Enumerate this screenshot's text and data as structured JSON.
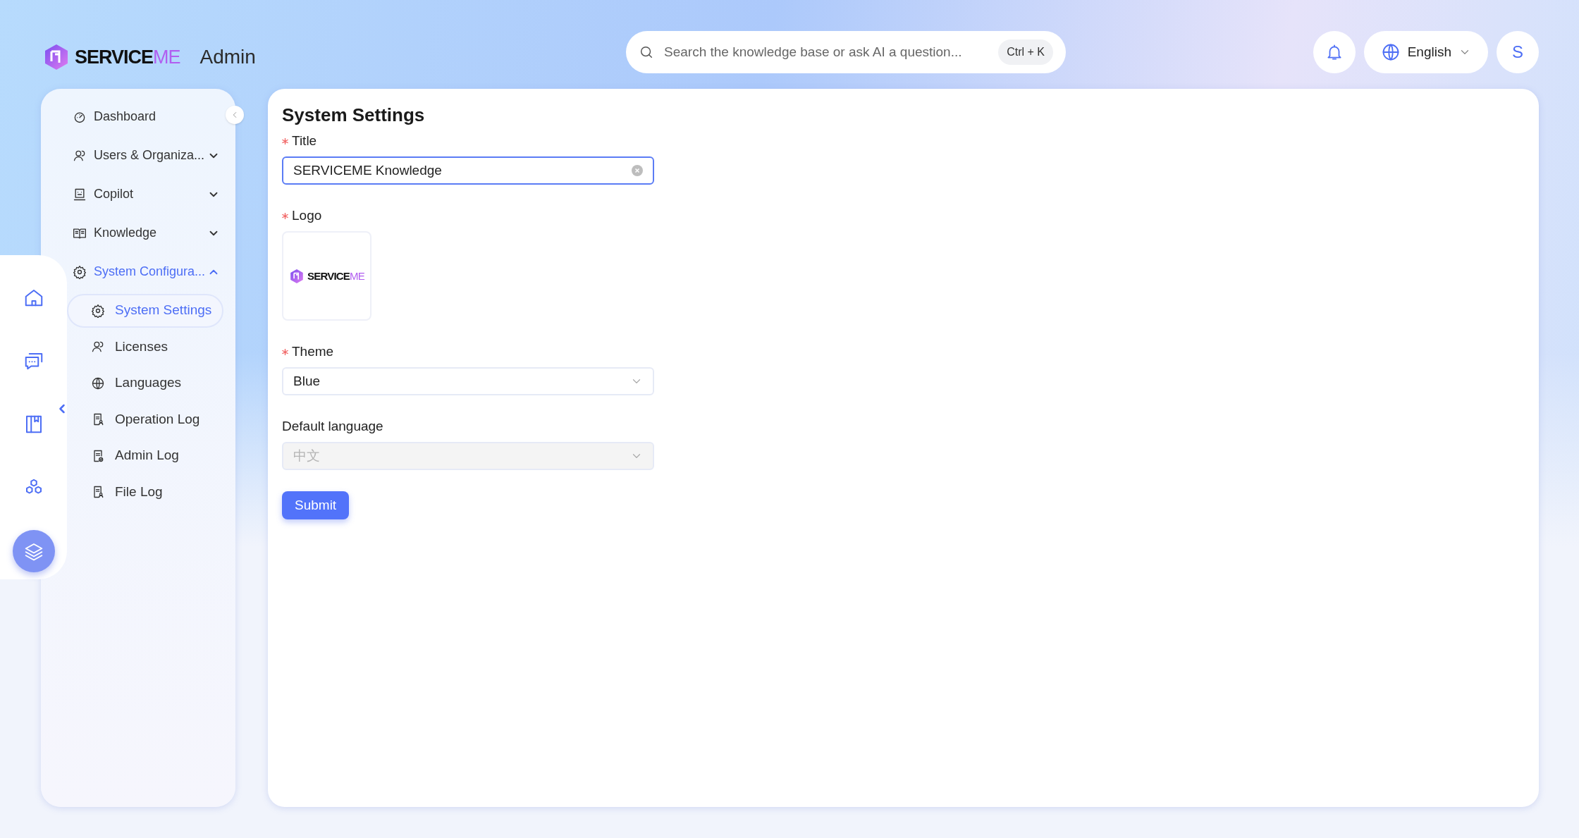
{
  "header": {
    "brand": {
      "main": "SERVICE",
      "accent": "ME"
    },
    "app_label": "Admin",
    "search": {
      "placeholder": "Search the knowledge base or ask AI a question...",
      "shortcut": "Ctrl + K"
    },
    "language": "English",
    "avatar": "S"
  },
  "rail": [
    {
      "selected": false
    },
    {
      "selected": false
    },
    {
      "selected": false
    },
    {
      "selected": false
    },
    {
      "selected": true
    }
  ],
  "sidebar": {
    "items": [
      {
        "label": "Dashboard",
        "selected": false
      },
      {
        "label": "Users & Organiza...",
        "expanded": false,
        "selected": false
      },
      {
        "label": "Copilot",
        "expanded": false,
        "selected": false
      },
      {
        "label": "Knowledge",
        "expanded": false,
        "selected": false
      },
      {
        "label": "System Configura...",
        "expanded": true,
        "selected": true,
        "children": [
          {
            "label": "System Settings",
            "selected": true
          },
          {
            "label": "Licenses",
            "selected": false
          },
          {
            "label": "Languages",
            "selected": false
          },
          {
            "label": "Operation Log",
            "selected": false
          },
          {
            "label": "Admin Log",
            "selected": false
          },
          {
            "label": "File Log",
            "selected": false
          }
        ]
      }
    ]
  },
  "page": {
    "title": "System Settings",
    "fields": [
      {
        "kind": "text",
        "label": "Title",
        "required": true,
        "value": "SERVICEME Knowledge",
        "focused": true
      },
      {
        "kind": "upload",
        "label": "Logo",
        "required": true,
        "logo": {
          "main": "SERVICE",
          "accent": "ME"
        }
      },
      {
        "kind": "select",
        "label": "Theme",
        "required": true,
        "value": "Blue",
        "disabled": false
      },
      {
        "kind": "select",
        "label": "Default language",
        "required": false,
        "value": "中文",
        "disabled": true
      }
    ],
    "submit": "Submit"
  }
}
